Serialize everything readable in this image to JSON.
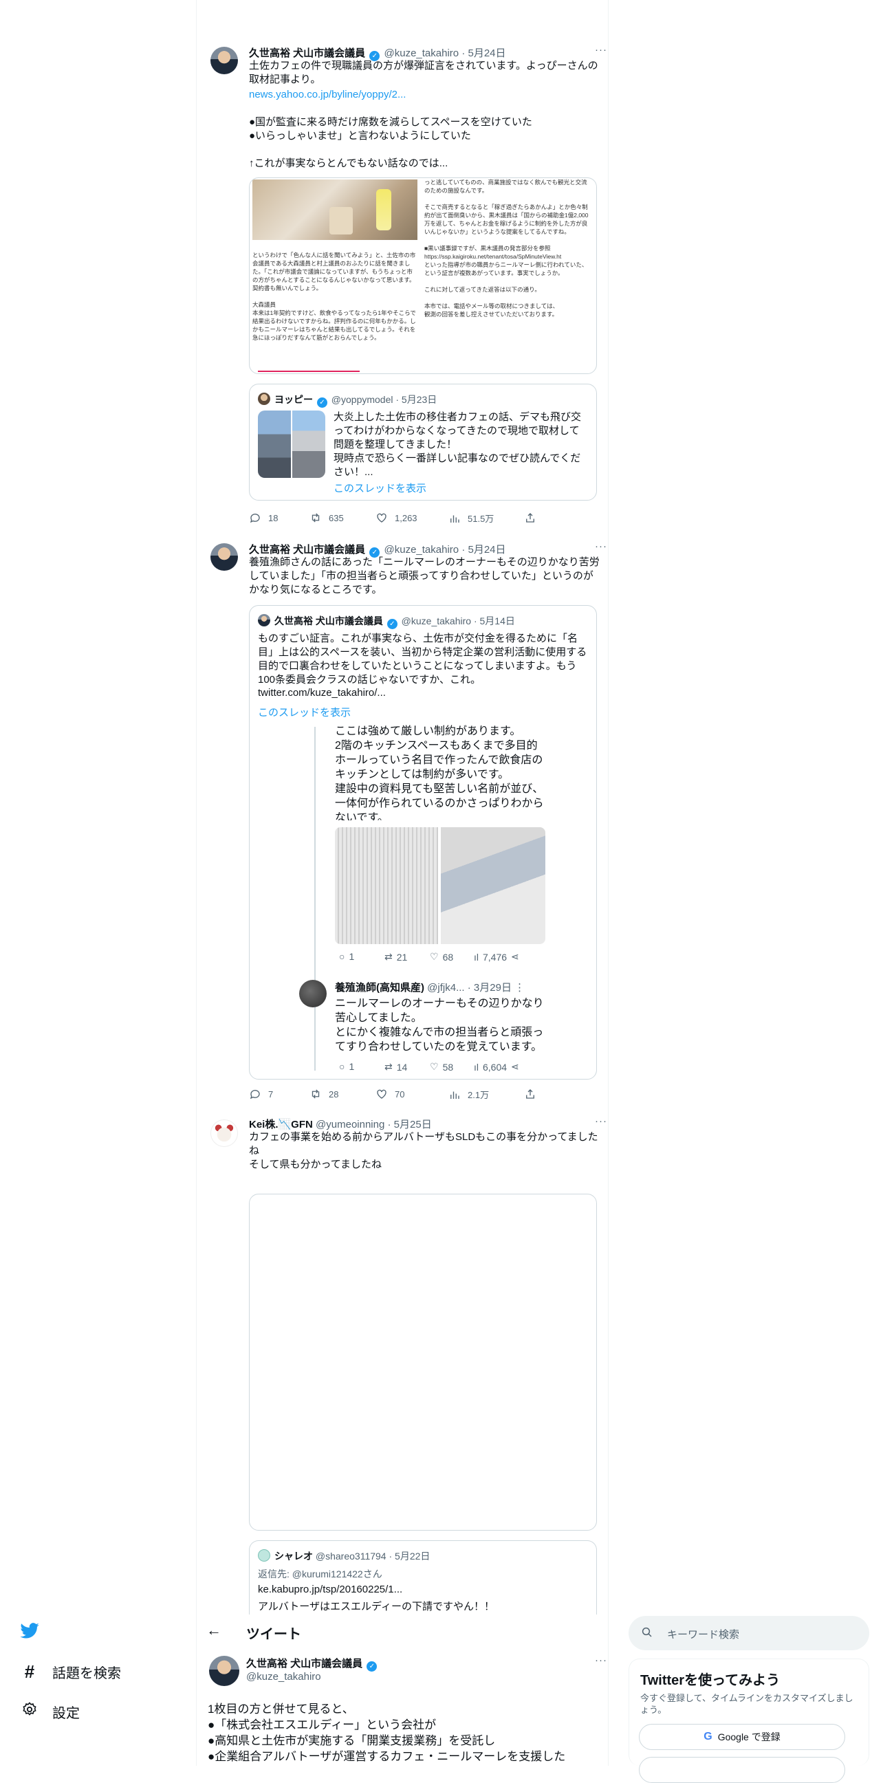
{
  "tweet1": {
    "name": "久世高裕 犬山市議会議員",
    "handle": "@kuze_takahiro",
    "date": "· 5月24日",
    "text": "土佐カフェの件で現職議員の方が爆弾証言をされています。よっぴーさんの取材記事より。",
    "link": "news.yahoo.co.jp/byline/yoppy/2...",
    "text2": "●国が監査に来る時だけ席数を減らしてスペースを空けていた\n●いらっしゃいませ」と言わないようにしていた\n\n↑これが事実ならとんでもない話なのでは...",
    "image_left_text": "というわけで「色んな人に話を聞いてみよう」と、土佐市の市会議員である大森議員と村上議員のおふたりに話を聞きました。「これが市議会で議論になっていますが、もうちょっと市の方がちゃんとすることになるんじゃないかなって思います。契約書も無いんでしょう。\n\n大森議員\n本来は1年契約ですけど、飲食やるってなったら1年やそこらで結果出るわけないですからね。評判作るのに何年もかかる。しかもニールマーレはちゃんと結果も出してるでしょう。それを急にほっぽりだすなんて筋がとおらんでしょう。",
    "image_right_text": "っと逃していてものの、商業施設ではなく飲んでも観光と交流のための施設なんです。\n\nそこで商売するとなると「稼ぎ過ぎたらあかんよ」とか色々制約が出て面倒臭いから、黒木議員は「国からの補助金1億2,000万を返して、ちゃんとお金を稼げるように制約を外した方が良いんじゃないか」というような提案をしてるんですね。\n\n■黒い議事録ですが、黒木議員の発言部分を参照\nhttps://ssp.kaigiroku.net/tenant/tosa/SpMinuteView.ht\nといった指導が市の職員からニールマーレ側に行われていた、という証言が複数あがっています。事実でしょうか。\n\nこれに対して返ってきた返答は以下の通り。\n\n本市では、電話やメール等の取材につきましては、\n観測の回答を差し控えさせていただいております。",
    "quote": {
      "name": "ヨッピー",
      "handle": "@yoppymodel",
      "date": "· 5月23日",
      "text": "大炎上した土佐市の移住者カフェの話、デマも飛び交ってわけがわからなくなってきたので現地で取材して問題を整理してきました！\n現時点で恐らく一番詳しい記事なのでぜひ読んでください！...",
      "thread": "このスレッドを表示"
    },
    "stats": {
      "replies": "18",
      "retweets": "635",
      "likes": "1,263",
      "views": "51.5万"
    }
  },
  "tweet2": {
    "name": "久世高裕 犬山市議会議員",
    "handle": "@kuze_takahiro",
    "date": "· 5月24日",
    "text": "養殖漁師さんの話にあった「ニールマーレのオーナーもその辺りかなり苦労していました」「市の担当者らと頑張ってすり合わせしていた」というのがかなり気になるところです。",
    "quote": {
      "name": "久世高裕 犬山市議会議員",
      "handle": "@kuze_takahiro",
      "date": "· 5月14日",
      "text": "ものすごい証言。これが事実なら、土佐市が交付金を得るために「名目」上は公的スペースを装い、当初から特定企業の営利活動に使用する目的で口裏合わせをしていたということになってしまいますよ。もう100条委員会クラスの話じゃないですか、これ。",
      "link": "twitter.com/kuze_takahiro/...",
      "thread": "このスレッドを表示",
      "embedded_text": "ここは強めて厳しい制約があります。\n2階のキッチンスペースもあくまで多目的ホールっていう名目で作ったんで飲食店のキッチンとしては制約が多いです。\n建設中の資料見ても堅苦しい名前が並び、一体何が作られているのかさっぱりわからないです。",
      "embedded_stats": {
        "replies": "1",
        "retweets": "21",
        "likes": "68",
        "views": "7,476"
      },
      "reply": {
        "name": "養殖漁師(高知県産)",
        "handle": "@jfjk4...",
        "date": "· 3月29日",
        "text": "ニールマーレのオーナーもその辺りかなり苦心してました。\nとにかく複雑なんで市の担当者らと頑張ってすり合わせしていたのを覚えています。",
        "stats": {
          "replies": "1",
          "retweets": "14",
          "likes": "58",
          "views": "6,604"
        }
      }
    },
    "stats": {
      "replies": "7",
      "retweets": "28",
      "likes": "70",
      "views": "2.1万"
    }
  },
  "tweet3": {
    "name": "Kei株.📉GFN",
    "handle": "@yumeoinning",
    "date": "· 5月25日",
    "text": "カフェの事業を始める前からアルバトーザもSLDもこの事を分かってましたね\nそして県も分かってましたね",
    "quote": {
      "name": "シャレオ",
      "handle": "@shareo311794",
      "date": "· 5月22日",
      "reply_to": "返信先: @kurumi121422さん",
      "link": "ke.kabupro.jp/tsp/20160225/1...",
      "text": "アルバトーザはエスエルディーの下請ですやん！！"
    }
  },
  "left_nav": {
    "explore": "話題を検索",
    "settings": "設定"
  },
  "header": {
    "title": "ツイート"
  },
  "main_tweet": {
    "name": "久世高裕 犬山市議会議員",
    "handle": "@kuze_takahiro",
    "text": "1枚目の方と併せて見ると、\n●「株式会社エスエルディー」という会社が\n●高知県と土佐市が実施する「開業支援業務」を受託し\n●企業組合アルバトーザが運営するカフェ・ニールマーレを支援した"
  },
  "right_sidebar": {
    "search_placeholder": "キーワード検索",
    "signup_title": "Twitterを使ってみよう",
    "signup_desc": "今すぐ登録して、タイムラインをカスタマイズしましょう。",
    "google_button": "Google で登録"
  },
  "colors": {
    "accent": "#1d9bf0",
    "text": "#0f1419",
    "muted": "#536471",
    "border": "#cfd9de"
  }
}
